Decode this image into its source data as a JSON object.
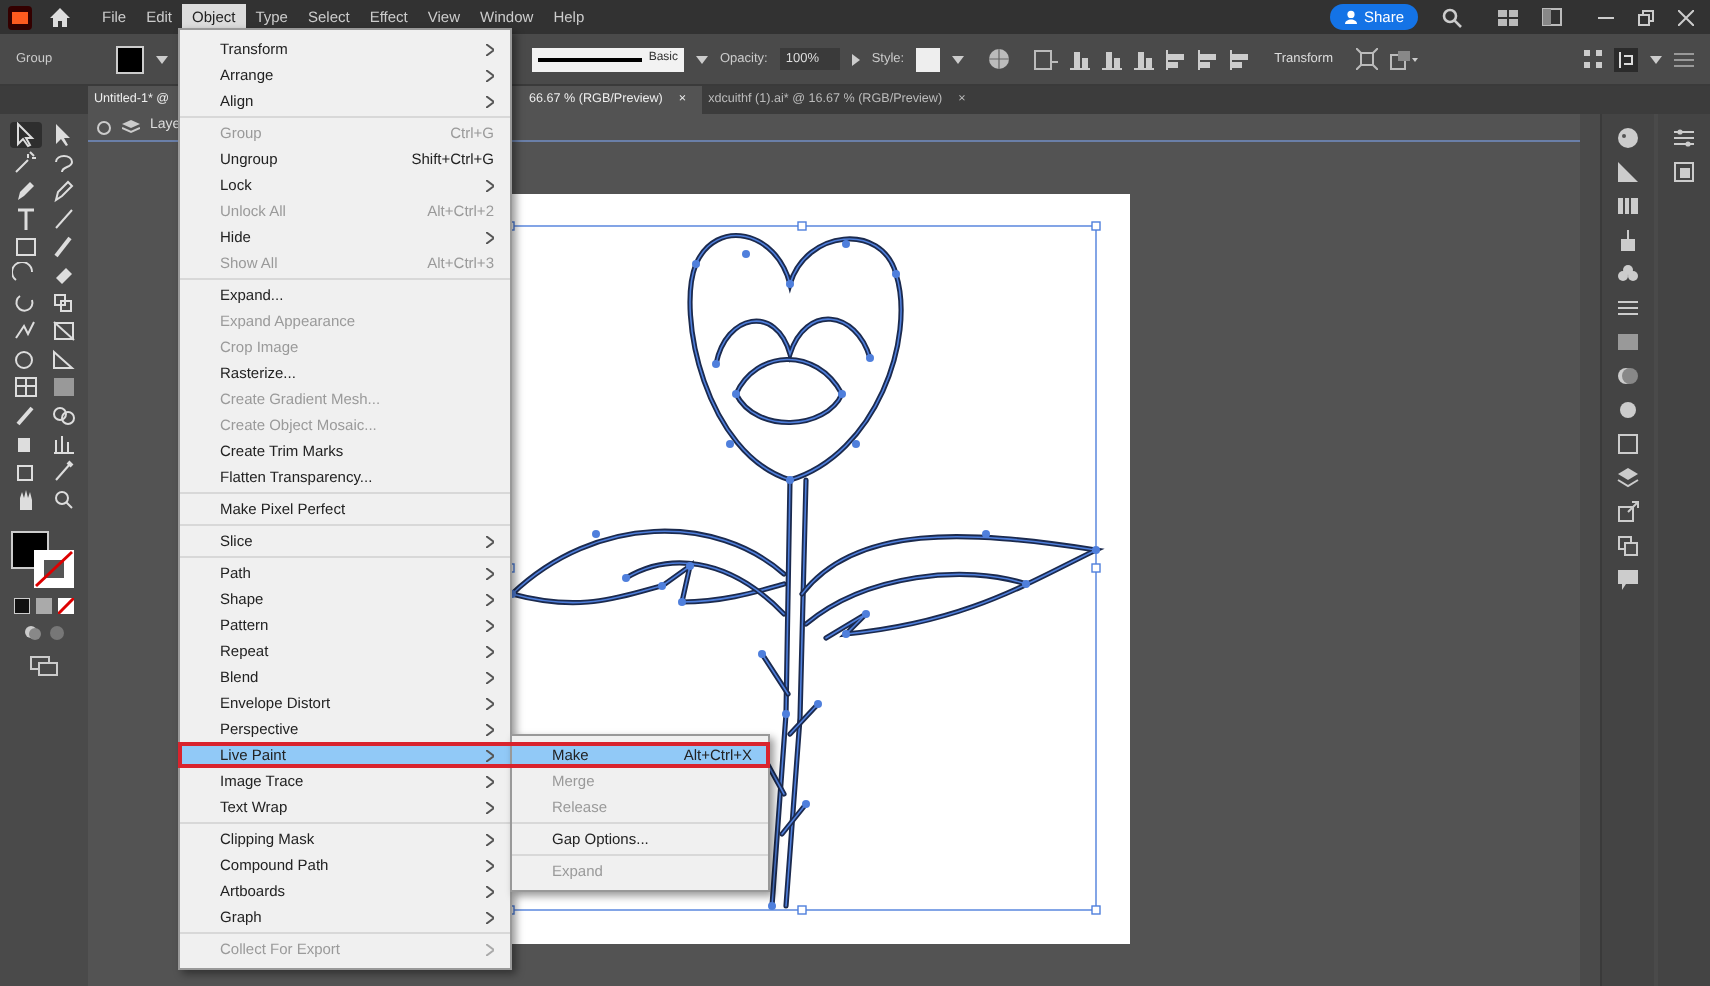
{
  "menu_bar": [
    {
      "label": "File",
      "selected": false
    },
    {
      "label": "Edit",
      "selected": false
    },
    {
      "label": "Object",
      "selected": true
    },
    {
      "label": "Type",
      "selected": false
    },
    {
      "label": "Select",
      "selected": false
    },
    {
      "label": "Effect",
      "selected": false
    },
    {
      "label": "View",
      "selected": false
    },
    {
      "label": "Window",
      "selected": false
    },
    {
      "label": "Help",
      "selected": false
    }
  ],
  "share_button": "Share",
  "control_bar": {
    "selection_label": "Group",
    "stroke_profile": "Basic",
    "opacity_label": "Opacity:",
    "opacity_value": "100%",
    "style_label": "Style:",
    "transform_link": "Transform"
  },
  "document_tabs": [
    {
      "label_parts": [
        "Untitled-1* @",
        "66.67 % (RGB/Preview)"
      ],
      "selected": true,
      "close": "×"
    },
    {
      "label_parts": [
        "xdcuithf (1).ai* @ 16.67 % (RGB/Preview)"
      ],
      "selected": false,
      "close": "×"
    }
  ],
  "layer_breadcrumb": "Laye",
  "tools": [
    {
      "selected": true
    },
    {
      "selected": false
    }
  ],
  "callout_outline": true,
  "object_menu": {
    "sections": [
      [
        {
          "label": "Transform",
          "submenu": true,
          "disabled": false,
          "selected": false
        },
        {
          "label": "Arrange",
          "submenu": true,
          "disabled": false,
          "selected": false
        },
        {
          "label": "Align",
          "submenu": true,
          "disabled": false,
          "selected": false
        }
      ],
      [
        {
          "label": "Group",
          "shortcut": "Ctrl+G",
          "submenu": false,
          "disabled": true,
          "selected": false
        },
        {
          "label": "Ungroup",
          "shortcut": "Shift+Ctrl+G",
          "submenu": false,
          "disabled": false,
          "selected": false
        },
        {
          "label": "Lock",
          "submenu": true,
          "disabled": false,
          "selected": false
        },
        {
          "label": "Unlock All",
          "shortcut": "Alt+Ctrl+2",
          "submenu": false,
          "disabled": true,
          "selected": false
        },
        {
          "label": "Hide",
          "submenu": true,
          "disabled": false,
          "selected": false
        },
        {
          "label": "Show All",
          "shortcut": "Alt+Ctrl+3",
          "submenu": false,
          "disabled": true,
          "selected": false
        }
      ],
      [
        {
          "label": "Expand...",
          "submenu": false,
          "disabled": false,
          "selected": false
        },
        {
          "label": "Expand Appearance",
          "submenu": false,
          "disabled": true,
          "selected": false
        },
        {
          "label": "Crop Image",
          "submenu": false,
          "disabled": true,
          "selected": false
        },
        {
          "label": "Rasterize...",
          "submenu": false,
          "disabled": false,
          "selected": false
        },
        {
          "label": "Create Gradient Mesh...",
          "submenu": false,
          "disabled": true,
          "selected": false
        },
        {
          "label": "Create Object Mosaic...",
          "submenu": false,
          "disabled": true,
          "selected": false
        },
        {
          "label": "Create Trim Marks",
          "submenu": false,
          "disabled": false,
          "selected": false
        },
        {
          "label": "Flatten Transparency...",
          "submenu": false,
          "disabled": false,
          "selected": false
        }
      ],
      [
        {
          "label": "Make Pixel Perfect",
          "submenu": false,
          "disabled": false,
          "selected": false
        }
      ],
      [
        {
          "label": "Slice",
          "submenu": true,
          "disabled": false,
          "selected": false
        }
      ],
      [
        {
          "label": "Path",
          "submenu": true,
          "disabled": false,
          "selected": false
        },
        {
          "label": "Shape",
          "submenu": true,
          "disabled": false,
          "selected": false
        },
        {
          "label": "Pattern",
          "submenu": true,
          "disabled": false,
          "selected": false
        },
        {
          "label": "Repeat",
          "submenu": true,
          "disabled": false,
          "selected": false
        },
        {
          "label": "Blend",
          "submenu": true,
          "disabled": false,
          "selected": false
        },
        {
          "label": "Envelope Distort",
          "submenu": true,
          "disabled": false,
          "selected": false
        },
        {
          "label": "Perspective",
          "submenu": true,
          "disabled": false,
          "selected": false
        },
        {
          "label": "Live Paint",
          "submenu": true,
          "disabled": false,
          "selected": true
        },
        {
          "label": "Image Trace",
          "submenu": true,
          "disabled": false,
          "selected": false
        },
        {
          "label": "Text Wrap",
          "submenu": true,
          "disabled": false,
          "selected": false
        }
      ],
      [
        {
          "label": "Clipping Mask",
          "submenu": true,
          "disabled": false,
          "selected": false
        },
        {
          "label": "Compound Path",
          "submenu": true,
          "disabled": false,
          "selected": false
        },
        {
          "label": "Artboards",
          "submenu": true,
          "disabled": false,
          "selected": false
        },
        {
          "label": "Graph",
          "submenu": true,
          "disabled": false,
          "selected": false
        }
      ],
      [
        {
          "label": "Collect For Export",
          "submenu": true,
          "disabled": true,
          "selected": false
        }
      ]
    ]
  },
  "live_paint_submenu": {
    "sections": [
      [
        {
          "label": "Make",
          "shortcut": "Alt+Ctrl+X",
          "submenu": false,
          "disabled": false,
          "selected": true
        },
        {
          "label": "Merge",
          "submenu": false,
          "disabled": true,
          "selected": false
        },
        {
          "label": "Release",
          "submenu": false,
          "disabled": true,
          "selected": false
        }
      ],
      [
        {
          "label": "Gap Options...",
          "submenu": false,
          "disabled": false,
          "selected": false
        }
      ],
      [
        {
          "label": "Expand",
          "submenu": false,
          "disabled": true,
          "selected": false
        }
      ]
    ]
  }
}
